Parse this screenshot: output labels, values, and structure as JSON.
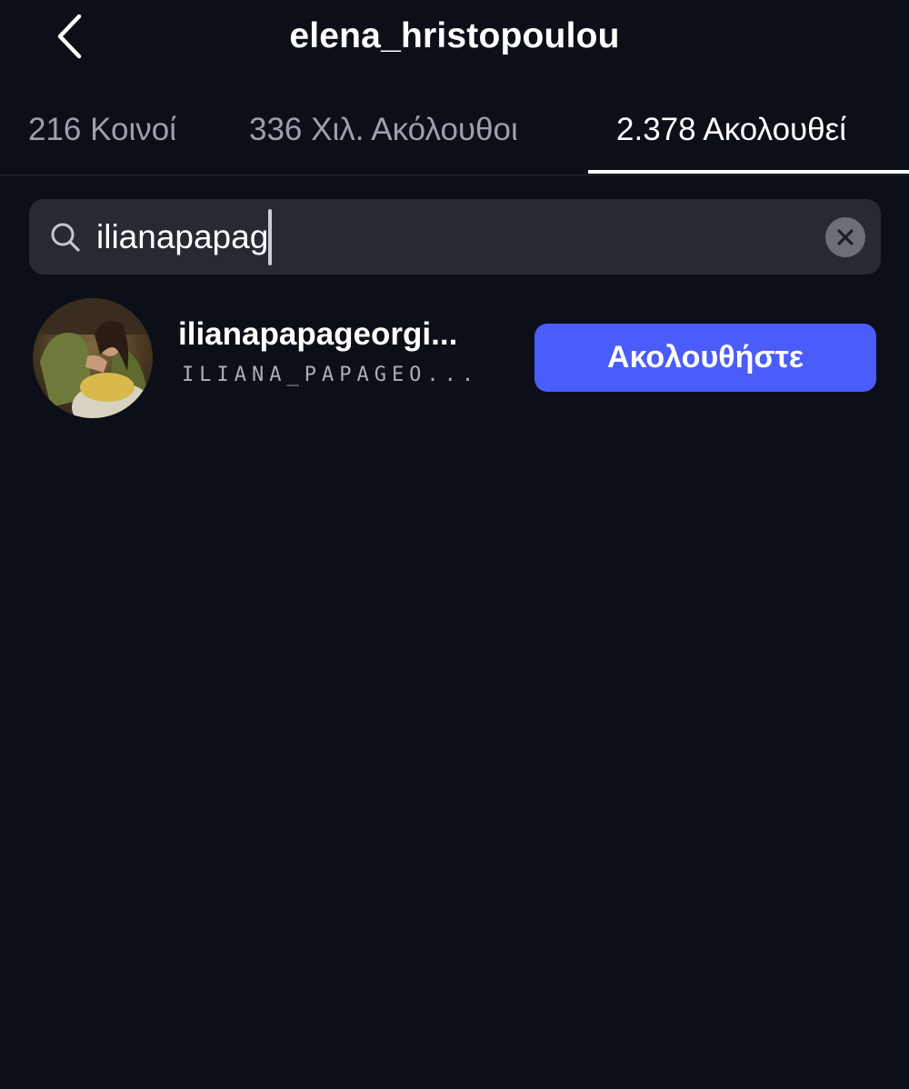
{
  "header": {
    "title": "elena_hristopoulou",
    "back_icon": "chevron-left-icon"
  },
  "tabs": [
    {
      "label": "216 Κοινοί",
      "active": false
    },
    {
      "label": "336 Χιλ. Ακόλουθοι",
      "active": false
    },
    {
      "label": "2.378 Ακολουθεί",
      "active": true
    }
  ],
  "search": {
    "value": "ilianapapag",
    "search_icon": "search-icon",
    "clear_icon": "clear-icon"
  },
  "results": [
    {
      "username": "ilianapapageorgi...",
      "full_name": "ILIANA_PAPAGEO...",
      "follow_label": "Ακολουθήστε"
    }
  ],
  "colors": {
    "background": "#0c0f17",
    "search_bg": "#262a33",
    "follow_button": "#4a5dfa",
    "inactive_tab": "#9aa1ad"
  }
}
